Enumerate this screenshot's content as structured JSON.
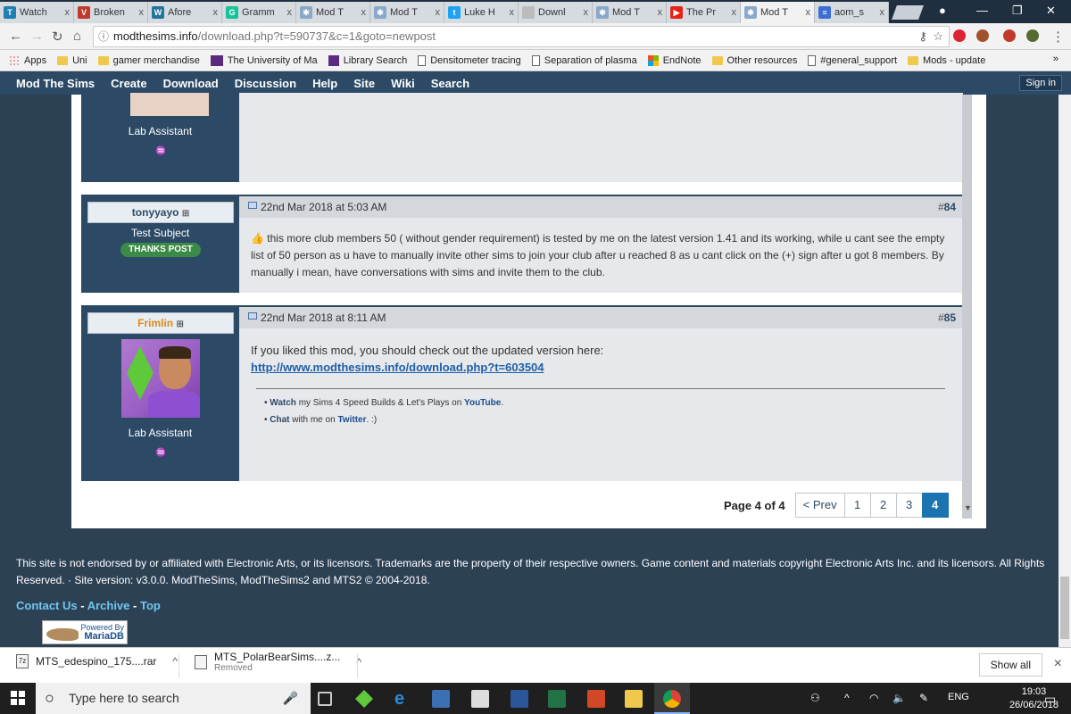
{
  "browser": {
    "tabs": [
      {
        "label": "Watch",
        "icon_color": "#1e7fb0",
        "icon_char": "T"
      },
      {
        "label": "Broken",
        "icon_color": "#c0392b",
        "icon_char": "V"
      },
      {
        "label": "Afore",
        "icon_color": "#21759b",
        "icon_char": "W"
      },
      {
        "label": "Gramm",
        "icon_color": "#15c39a",
        "icon_char": "G"
      },
      {
        "label": "Mod T",
        "icon_color": "#8aa8c8",
        "icon_char": "✱"
      },
      {
        "label": "Mod T",
        "icon_color": "#8aa8c8",
        "icon_char": "✱"
      },
      {
        "label": "Luke H",
        "icon_color": "#1da1f2",
        "icon_char": "t"
      },
      {
        "label": "Downl",
        "icon_color": "#bbbbbb",
        "icon_char": ""
      },
      {
        "label": "Mod T",
        "icon_color": "#8aa8c8",
        "icon_char": "✱"
      },
      {
        "label": "The Pr",
        "icon_color": "#e62117",
        "icon_char": "▶"
      },
      {
        "label": "Mod T",
        "icon_color": "#8aa8c8",
        "icon_char": "✱"
      },
      {
        "label": "aom_s",
        "icon_color": "#3b6fd4",
        "icon_char": "≡"
      }
    ],
    "tab_close": "x",
    "url_host": "modthesims.info",
    "url_path": "/download.php?t=590737&c=1&goto=newpost",
    "bookmarks": [
      {
        "label": "Apps",
        "kind": "apps"
      },
      {
        "label": "Uni",
        "kind": "folder"
      },
      {
        "label": "gamer merchandise",
        "kind": "folder"
      },
      {
        "label": "The University of Ma",
        "kind": "my"
      },
      {
        "label": "Library Search",
        "kind": "m"
      },
      {
        "label": "Densitometer tracing",
        "kind": "doc"
      },
      {
        "label": "Separation of plasma",
        "kind": "doc"
      },
      {
        "label": "EndNote",
        "kind": "ms"
      },
      {
        "label": "Other resources",
        "kind": "folder"
      },
      {
        "label": "#general_support",
        "kind": "doc"
      },
      {
        "label": "Mods - update",
        "kind": "folder"
      }
    ],
    "bookmarks_more": "»"
  },
  "site_nav": {
    "items": [
      "Mod The Sims",
      "Create",
      "Download",
      "Discussion",
      "Help",
      "Site",
      "Wiki",
      "Search"
    ],
    "signin": "Sign in"
  },
  "posts": {
    "prev_role": "Lab Assistant",
    "p84": {
      "user": "tonyyayo",
      "role": "Test Subject",
      "badge": "THANKS POST",
      "date": "22nd Mar 2018 at 5:03 AM",
      "num_prefix": "#",
      "num": "84",
      "body": "this more club members 50 ( without gender requirement) is tested by me on the latest version 1.41 and its working, while u cant see the empty list of 50 person as u have to manually invite other sims to join your club after u reached 8 as u cant click on the (+) sign after u got 8 members. By manually i mean, have conversations with sims and invite them to the club."
    },
    "p85": {
      "user": "Frimlin",
      "role": "Lab Assistant",
      "date": "22nd Mar 2018 at 8:11 AM",
      "num_prefix": "#",
      "num": "85",
      "line1": "If you liked this mod, you should check out the updated version here:",
      "link": "http://www.modthesims.info/download.php?t=603504",
      "sig1_bold": "Watch",
      "sig1_text": " my Sims 4 Speed Builds & Let's Plays on ",
      "sig1_link": "YouTube",
      "sig1_end": ".",
      "sig2_bold": "Chat",
      "sig2_text": " with me on ",
      "sig2_link": "Twitter",
      "sig2_end": ". :)"
    }
  },
  "pager": {
    "label": "Page 4 of 4",
    "prev": "< Prev",
    "pages": [
      "1",
      "2",
      "3",
      "4"
    ],
    "current": "4"
  },
  "footer": {
    "text": "This site is not endorsed by or affiliated with Electronic Arts, or its licensors. Trademarks are the property of their respective owners. Game content and materials copyright Electronic Arts Inc. and its licensors. All Rights Reserved. · Site version: v3.0.0. ModTheSims, ModTheSims2 and MTS2 © 2004-2018.",
    "links": [
      "Contact Us",
      "Archive",
      "Top"
    ],
    "link_sep": " - ",
    "powered_line1": "Powered By",
    "powered_line2": "MariaDB"
  },
  "downloads": {
    "items": [
      {
        "name": "MTS_edespino_175....rar",
        "sub": ""
      },
      {
        "name": "MTS_PolarBearSims....z...",
        "sub": "Removed"
      }
    ],
    "show_all": "Show all",
    "close": "×"
  },
  "taskbar": {
    "search_placeholder": "Type here to search",
    "lang": "ENG",
    "time": "19:03",
    "date": "26/06/2018"
  }
}
